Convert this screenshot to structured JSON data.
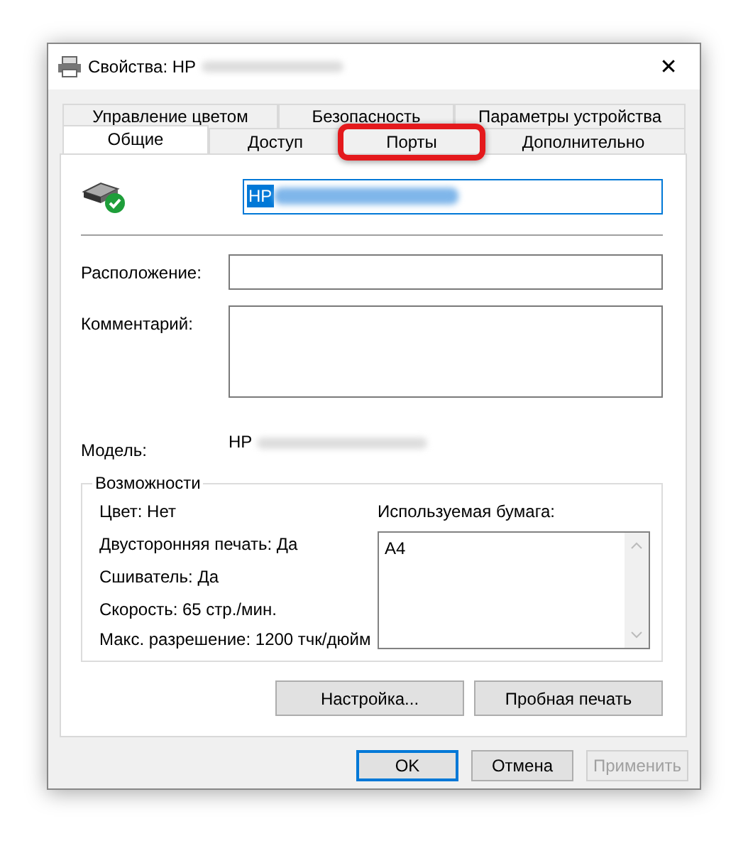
{
  "window": {
    "title": "Свойства: HP",
    "close": "✕"
  },
  "tab_rows": [
    [
      {
        "label": "Управление цветом",
        "selected": false,
        "highlighted": false
      },
      {
        "label": "Безопасность",
        "selected": false,
        "highlighted": false
      },
      {
        "label": "Параметры устройства",
        "selected": false,
        "highlighted": false
      }
    ],
    [
      {
        "label": "Общие",
        "selected": true,
        "highlighted": false
      },
      {
        "label": "Доступ",
        "selected": false,
        "highlighted": false
      },
      {
        "label": "Порты",
        "selected": false,
        "highlighted": true
      },
      {
        "label": "Дополнительно",
        "selected": false,
        "highlighted": false
      }
    ]
  ],
  "printer_name": {
    "value": "HP",
    "selected": true
  },
  "location": {
    "label": "Расположение:"
  },
  "comment": {
    "label": "Комментарий:"
  },
  "model": {
    "label": "Модель:",
    "value": "HP"
  },
  "features": {
    "title": "Возможности",
    "items": [
      "Цвет: Нет",
      "Двусторонняя печать: Да",
      "Сшиватель: Да",
      "Скорость: 65 стр./мин.",
      "Макс. разрешение: 1200 тчк/дюйм"
    ],
    "paper_label": "Используемая бумага:",
    "paper": [
      "A4"
    ]
  },
  "panel_buttons": [
    {
      "label": "Настройка...",
      "disabled": false
    },
    {
      "label": "Пробная печать",
      "disabled": false
    }
  ],
  "dialog_buttons": [
    {
      "label": "OK",
      "disabled": false,
      "default": true
    },
    {
      "label": "Отмена",
      "disabled": false,
      "default": false
    },
    {
      "label": "Применить",
      "disabled": true,
      "default": false
    }
  ]
}
